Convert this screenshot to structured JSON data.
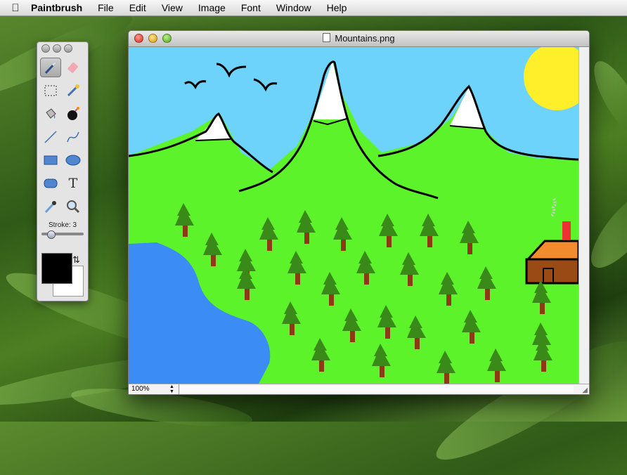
{
  "menubar": {
    "app_name": "Paintbrush",
    "menus": [
      "File",
      "Edit",
      "View",
      "Image",
      "Font",
      "Window",
      "Help"
    ]
  },
  "palette": {
    "tools": [
      {
        "name": "brush-tool",
        "icon": "paintbrush-icon",
        "selected": true
      },
      {
        "name": "eraser-tool",
        "icon": "eraser-icon"
      },
      {
        "name": "selection-tool",
        "icon": "dashed-rect-icon"
      },
      {
        "name": "magic-wand-tool",
        "icon": "wand-icon"
      },
      {
        "name": "fill-tool",
        "icon": "paint-bucket-icon"
      },
      {
        "name": "bomb-tool",
        "icon": "bomb-icon"
      },
      {
        "name": "line-tool",
        "icon": "line-icon"
      },
      {
        "name": "curve-tool",
        "icon": "curve-icon"
      },
      {
        "name": "rectangle-tool",
        "icon": "rectangle-icon"
      },
      {
        "name": "ellipse-tool",
        "icon": "ellipse-icon"
      },
      {
        "name": "rounded-rect-tool",
        "icon": "rounded-rect-icon"
      },
      {
        "name": "text-tool",
        "icon": "text-T-icon",
        "glyph": "T"
      },
      {
        "name": "eyedropper-tool",
        "icon": "eyedropper-icon"
      },
      {
        "name": "zoom-tool",
        "icon": "magnifier-icon"
      }
    ],
    "stroke_label": "Stroke: 3",
    "stroke_value": 3,
    "foreground_color": "#000000",
    "background_color": "#ffffff"
  },
  "window": {
    "title": "Mountains.png",
    "zoom": "100%"
  },
  "colors": {
    "sky": "#6ed3fb",
    "grass": "#5df32b",
    "water": "#3c8cf5",
    "sun": "#ffef2a",
    "tree": "#3a8a1a",
    "trunk": "#8b3a13",
    "house": "#9a4a14",
    "roof": "#f28a2e"
  }
}
